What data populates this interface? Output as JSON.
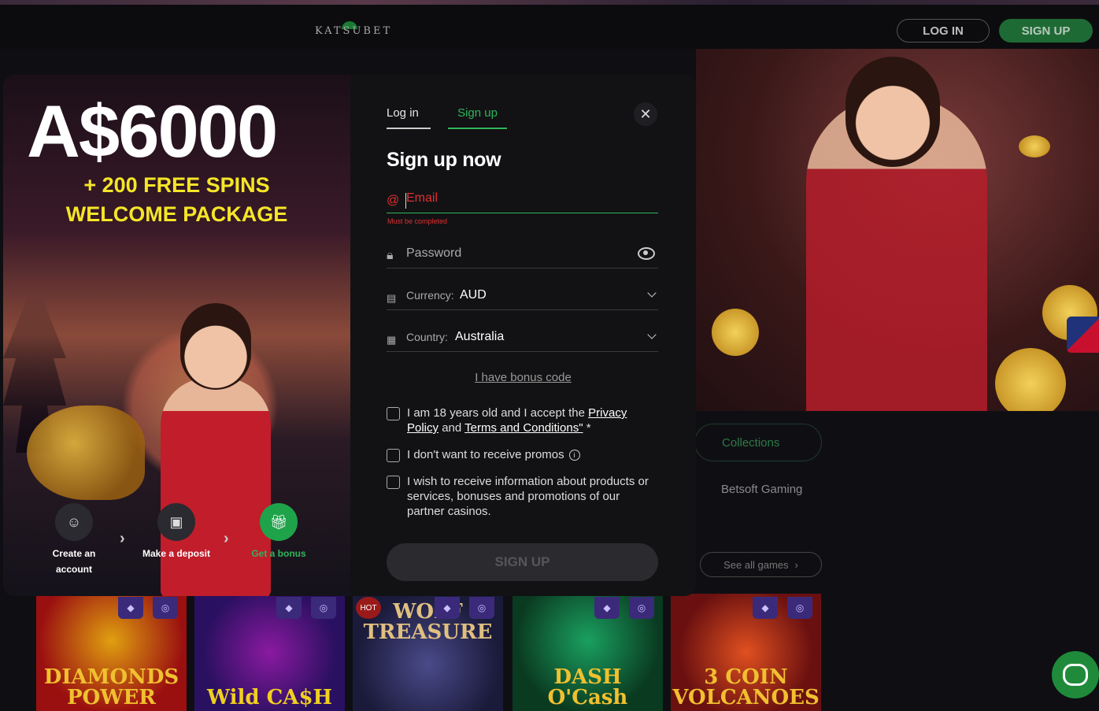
{
  "header": {
    "logo_text": "KATSUBET",
    "login_label": "LOG IN",
    "signup_label": "SIGN UP"
  },
  "promo": {
    "amount": "A$6000",
    "line1": "+ 200 FREE SPINS",
    "line2": "WELCOME PACKAGE",
    "steps": [
      {
        "label1": "Create an",
        "label2": "account"
      },
      {
        "label": "Make a deposit"
      },
      {
        "label": "Get a bonus"
      }
    ]
  },
  "form": {
    "tabs": [
      "Log in",
      "Sign up"
    ],
    "active_tab": "Sign up",
    "title": "Sign up now",
    "email_placeholder": "Email",
    "email_error": "Must be completed",
    "password_placeholder": "Password",
    "currency_label": "Currency:",
    "currency_value": "AUD",
    "country_label": "Country:",
    "country_value": "Australia",
    "bonus_link": "I have bonus code",
    "age_text": "I am 18 years old and I accept the",
    "privacy_link1": "Privacy",
    "privacy_link2": "Policy",
    "and_text": "and",
    "terms_link": "Terms and Conditions\"",
    "asterisk": "*",
    "no_promos_text": "I don't want to receive promos",
    "partner_text": "I wish to receive information about products or services, bonuses and promotions of our partner casinos.",
    "submit_label": "SIGN UP"
  },
  "background": {
    "collections_label": "Collections",
    "provider_label": "Betsoft Gaming",
    "see_all_label": "See all games",
    "games": [
      {
        "title": "DIAMONDS POWER"
      },
      {
        "title": "Wild CA$H"
      },
      {
        "title": "WOLF TREASURE",
        "badge": "HOT"
      },
      {
        "title": "DASH O'Cash"
      },
      {
        "title": "3 COIN VOLCANOES"
      }
    ]
  },
  "colors": {
    "accent_green": "#2fb55a",
    "promo_yellow": "#f5e628",
    "error_red": "#e03030"
  }
}
